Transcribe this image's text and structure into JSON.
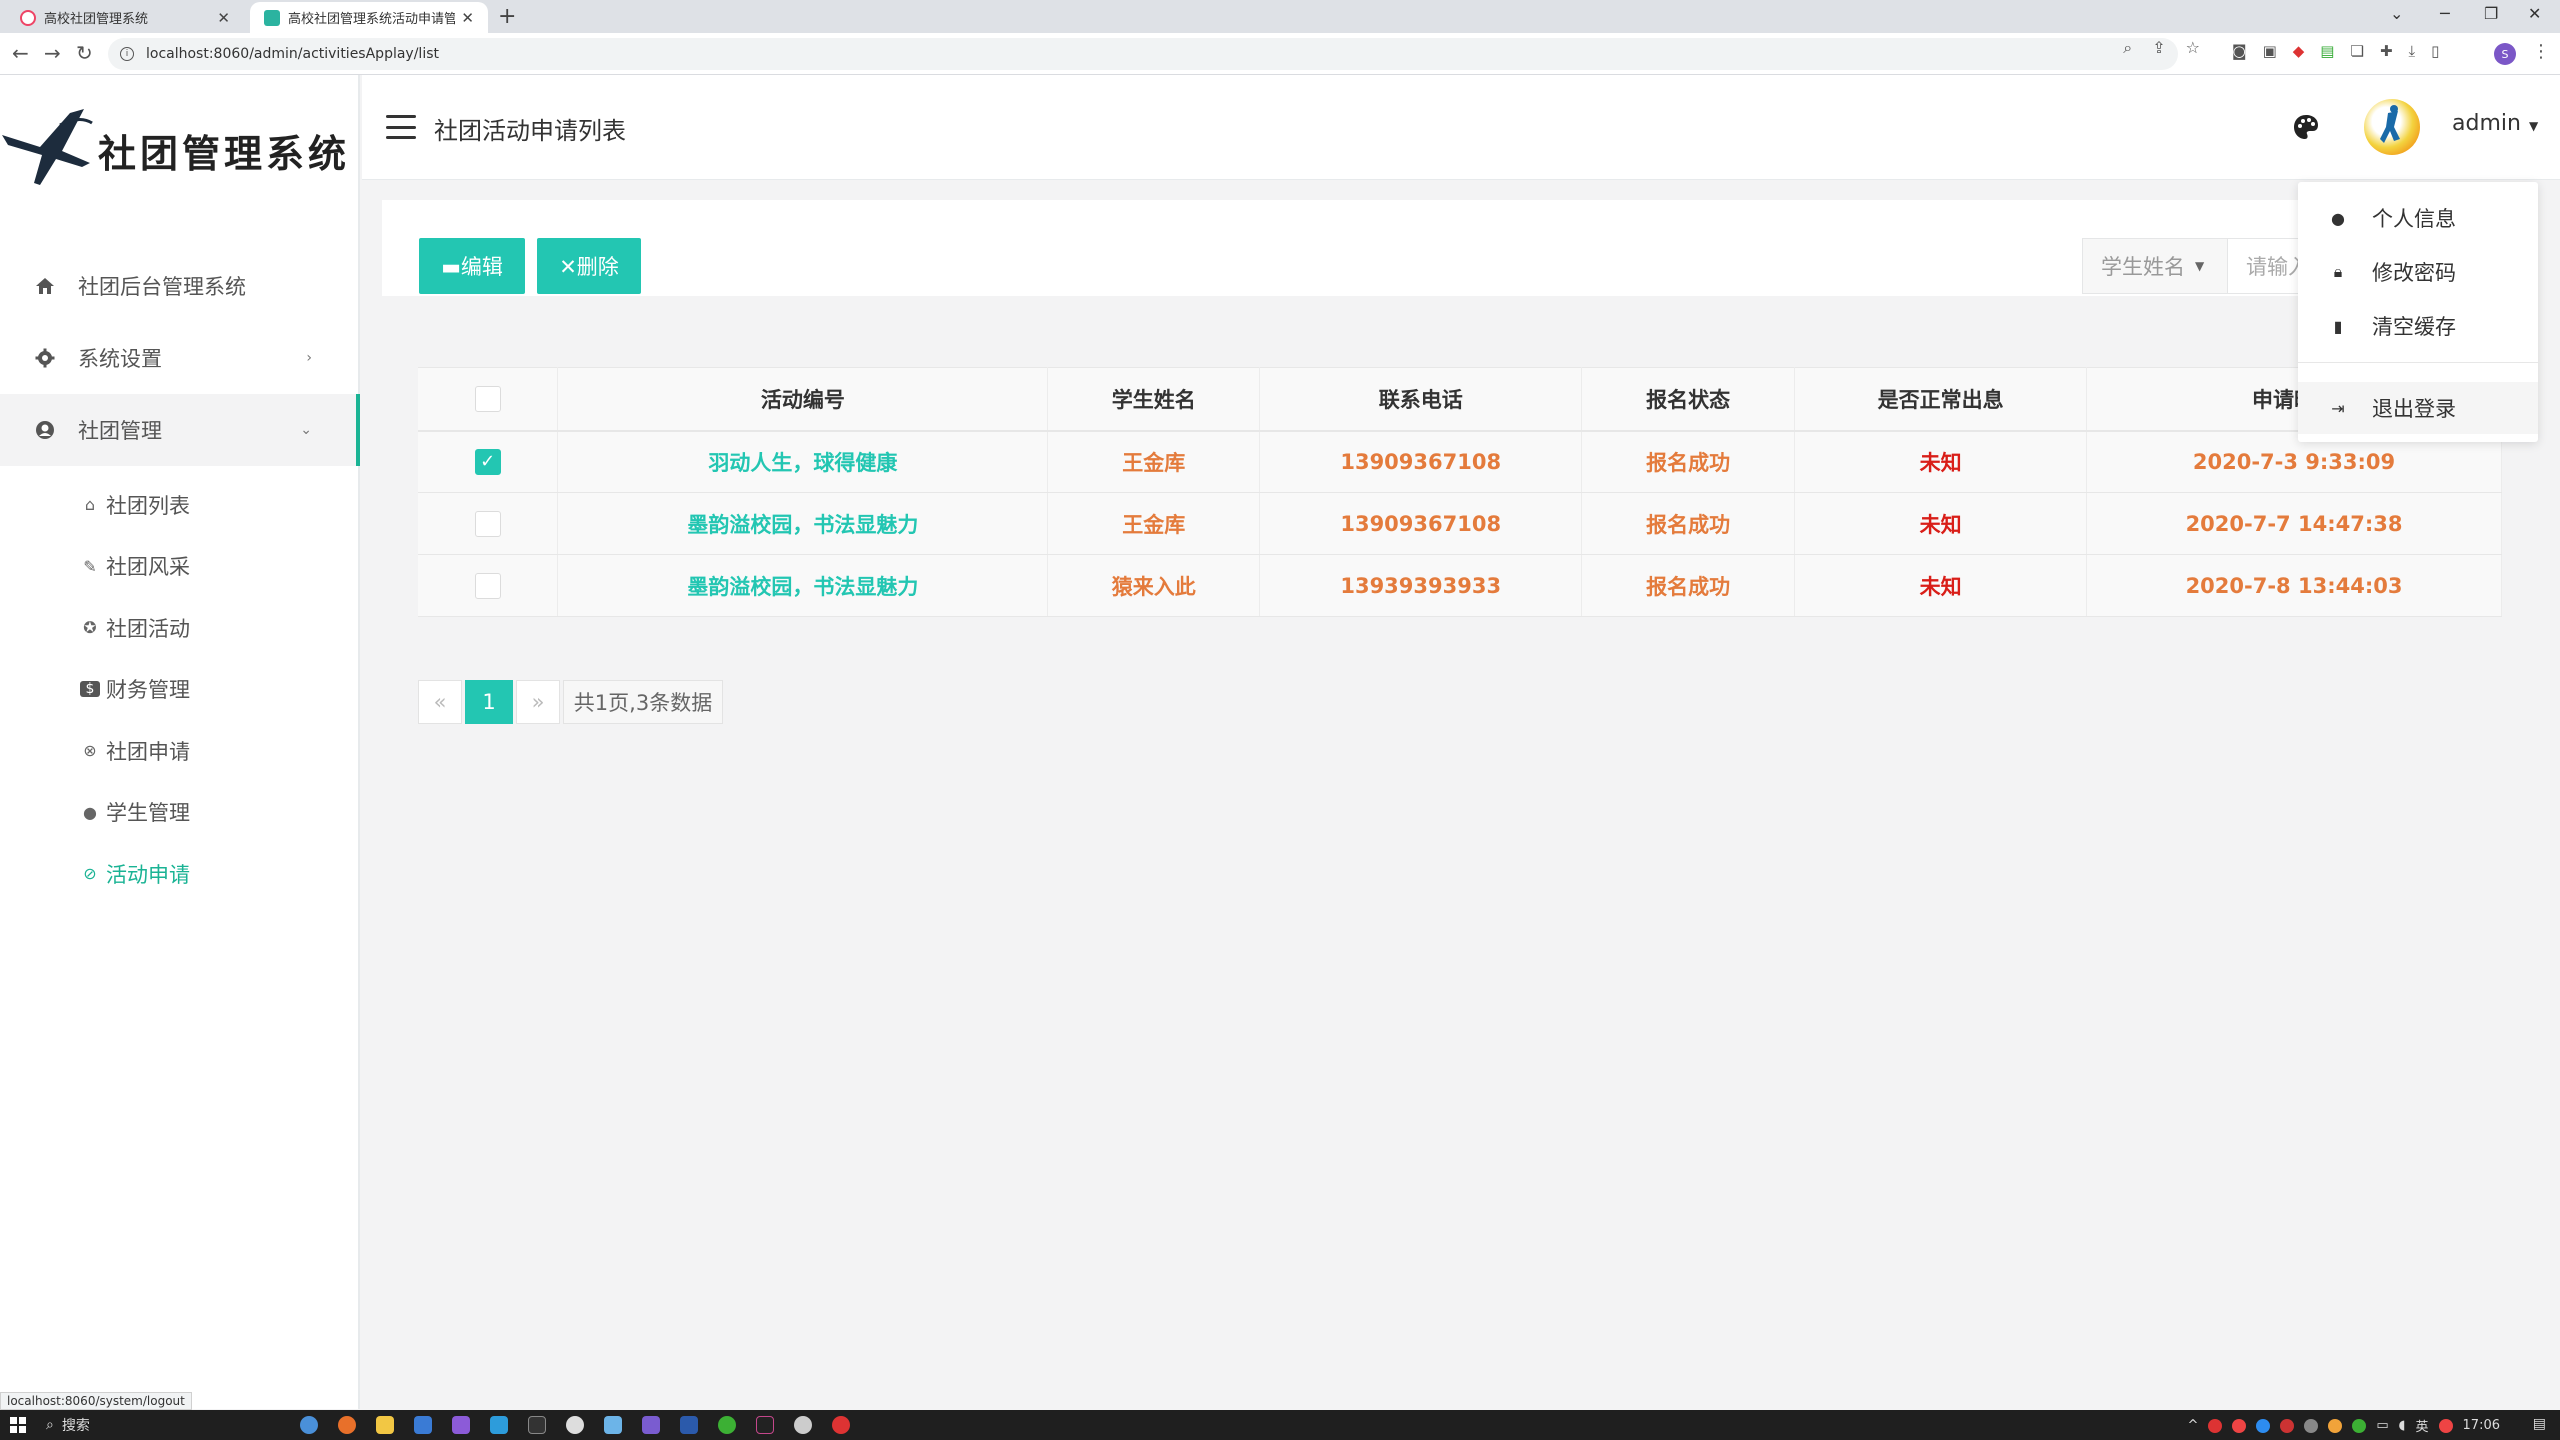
{
  "browser": {
    "tabs": [
      {
        "title": "高校社团管理系统",
        "active": false
      },
      {
        "title": "高校社团管理系统活动申请管理",
        "active": true
      }
    ],
    "url": "localhost:8060/admin/activitiesApplay/list",
    "profile_initial": "S"
  },
  "sidebar": {
    "logo_text": "社团管理系统",
    "menu": [
      {
        "label": "社团后台管理系统",
        "icon": "home-icon"
      },
      {
        "label": "系统设置",
        "icon": "gear-icon",
        "arrow": "›"
      },
      {
        "label": "社团管理",
        "icon": "group-icon",
        "arrow": "⌄"
      }
    ],
    "submenu": [
      {
        "label": "社团列表",
        "icon": "home-icon",
        "glyph": "⌂"
      },
      {
        "label": "社团风采",
        "icon": "feather-icon",
        "glyph": "✎"
      },
      {
        "label": "社团活动",
        "icon": "star-circle-icon",
        "glyph": "✪"
      },
      {
        "label": "财务管理",
        "icon": "dollar-icon",
        "glyph": "$"
      },
      {
        "label": "社团申请",
        "icon": "xbox-icon",
        "glyph": "⊗"
      },
      {
        "label": "学生管理",
        "icon": "user-circle-icon",
        "glyph": "●"
      },
      {
        "label": "活动申请",
        "icon": "globe-icon",
        "glyph": "⊘"
      }
    ]
  },
  "header": {
    "title": "社团活动申请列表",
    "user": "admin"
  },
  "toolbar": {
    "edit_label": "▬编辑",
    "delete_label": "✕删除",
    "search_field": "学生姓名",
    "search_placeholder": "请输入"
  },
  "table": {
    "columns": [
      "活动编号",
      "学生姓名",
      "联系电话",
      "报名状态",
      "是否正常出息",
      "申请时间"
    ],
    "rows": [
      {
        "checked": true,
        "activity": "羽动人生，球得健康",
        "student": "王金库",
        "phone": "13909367108",
        "status": "报名成功",
        "attendance": "未知",
        "time": "2020-7-3 9:33:09"
      },
      {
        "checked": false,
        "activity": "墨韵溢校园，书法显魅力",
        "student": "王金库",
        "phone": "13909367108",
        "status": "报名成功",
        "attendance": "未知",
        "time": "2020-7-7 14:47:38"
      },
      {
        "checked": false,
        "activity": "墨韵溢校园，书法显魅力",
        "student": "猿来入此",
        "phone": "13939393933",
        "status": "报名成功",
        "attendance": "未知",
        "time": "2020-7-8 13:44:03"
      }
    ]
  },
  "pagination": {
    "prev": "«",
    "current": "1",
    "next": "»",
    "summary": "共1页,3条数据"
  },
  "user_menu": {
    "items": [
      {
        "label": "个人信息",
        "icon": "user-icon"
      },
      {
        "label": "修改密码",
        "icon": "lock-icon"
      },
      {
        "label": "清空缓存",
        "icon": "trash-icon"
      },
      {
        "label": "退出登录",
        "icon": "logout-icon"
      }
    ]
  },
  "status_hint": "localhost:8060/system/logout",
  "taskbar": {
    "search_label": "搜索",
    "time": "17:06",
    "ime": "英"
  },
  "colors": {
    "accent": "#23c6b2",
    "active_menu": "#1ab394",
    "orange": "#e47b3c",
    "red": "#d91e18"
  }
}
